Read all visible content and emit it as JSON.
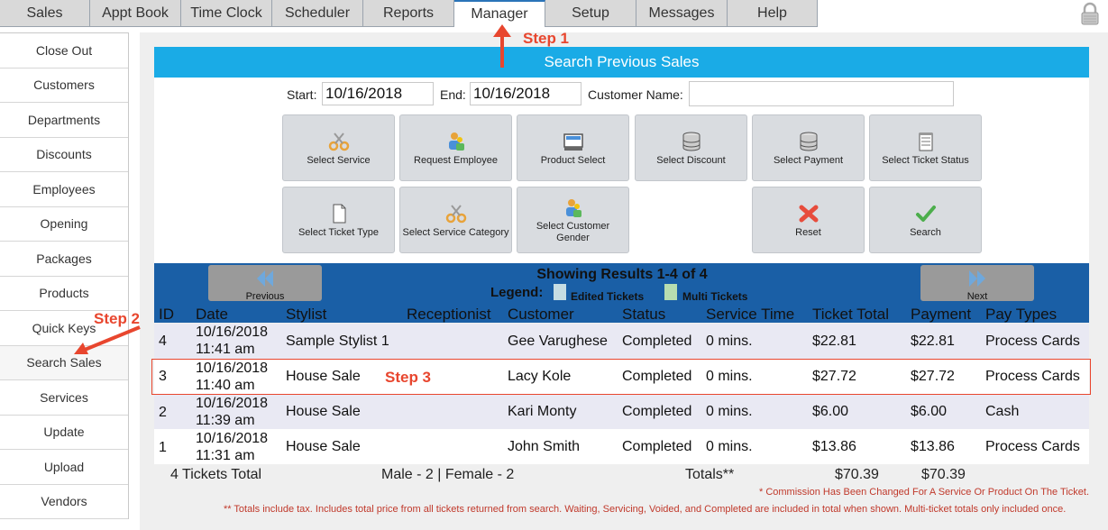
{
  "tabs": [
    "Sales",
    "Appt Book",
    "Time Clock",
    "Scheduler",
    "Reports",
    "Manager",
    "Setup",
    "Messages",
    "Help"
  ],
  "active_tab": "Manager",
  "sidebar": [
    "Close Out",
    "Customers",
    "Departments",
    "Discounts",
    "Employees",
    "Opening",
    "Packages",
    "Products",
    "Quick Keys",
    "Search Sales",
    "Services",
    "Update",
    "Upload",
    "Vendors"
  ],
  "active_sidebar": "Search Sales",
  "title": "Search Previous Sales",
  "form": {
    "start_label": "Start:",
    "start_value": "10/16/2018",
    "end_label": "End:",
    "end_value": "10/16/2018",
    "customer_label": "Customer Name:",
    "customer_value": ""
  },
  "buttons": {
    "select_service": "Select Service",
    "request_employee": "Request Employee",
    "product_select": "Product Select",
    "select_discount": "Select Discount",
    "select_payment": "Select Payment",
    "select_ticket_status": "Select Ticket Status",
    "select_ticket_type": "Select Ticket Type",
    "select_service_category": "Select Service Category",
    "select_customer_gender_1": "Select Customer",
    "select_customer_gender_2": "Gender",
    "reset": "Reset",
    "search": "Search"
  },
  "results": {
    "showing": "Showing Results 1-4 of 4",
    "legend_label": "Legend:",
    "legend_edited": "Edited Tickets",
    "legend_multi": "Multi Tickets",
    "previous": "Previous",
    "next": "Next",
    "columns": [
      "ID",
      "Date",
      "Stylist",
      "Receptionist",
      "Customer",
      "Status",
      "Service Time",
      "Ticket Total",
      "Payment",
      "Pay Types"
    ],
    "rows": [
      {
        "id": "4",
        "date1": "10/16/2018",
        "date2": "11:41 am",
        "stylist": "Sample Stylist 1",
        "receptionist": "",
        "customer": "Gee Varughese",
        "status": "Completed",
        "service_time": "0 mins.",
        "ticket_total": "$22.81",
        "payment": "$22.81",
        "pay_types": "Process Cards"
      },
      {
        "id": "3",
        "date1": "10/16/2018",
        "date2": "11:40 am",
        "stylist": "House Sale",
        "receptionist": "",
        "customer": "Lacy Kole",
        "status": "Completed",
        "service_time": "0 mins.",
        "ticket_total": "$27.72",
        "payment": "$27.72",
        "pay_types": "Process Cards"
      },
      {
        "id": "2",
        "date1": "10/16/2018",
        "date2": "11:39 am",
        "stylist": "House Sale",
        "receptionist": "",
        "customer": "Kari Monty",
        "status": "Completed",
        "service_time": "0 mins.",
        "ticket_total": "$6.00",
        "payment": "$6.00",
        "pay_types": "Cash"
      },
      {
        "id": "1",
        "date1": "10/16/2018",
        "date2": "11:31 am",
        "stylist": "House Sale",
        "receptionist": "",
        "customer": "John Smith",
        "status": "Completed",
        "service_time": "0 mins.",
        "ticket_total": "$13.86",
        "payment": "$13.86",
        "pay_types": "Process Cards"
      }
    ],
    "tickets_total": "4 Tickets Total",
    "gender_summary": "Male - 2 | Female - 2",
    "totals_label": "Totals**",
    "totals_ticket": "$70.39",
    "totals_payment": "$70.39",
    "note_commission": "* Commission Has Been Changed For A Service Or Product On The Ticket.",
    "note_totals": "** Totals include tax. Includes total price from all tickets returned from search. Waiting, Servicing, Voided, and Completed are included in total when shown. Multi-ticket totals only included once."
  },
  "annotations": {
    "step1": "Step 1",
    "step2": "Step 2",
    "step3": "Step 3"
  },
  "colors": {
    "title_bar": "#1aabe6",
    "results_bar": "#1a5fa6",
    "annotation": "#e8462e",
    "legend_edited": "#c6dde3",
    "legend_multi": "#b7ddb0",
    "row_alt": "#e9e9f3"
  }
}
